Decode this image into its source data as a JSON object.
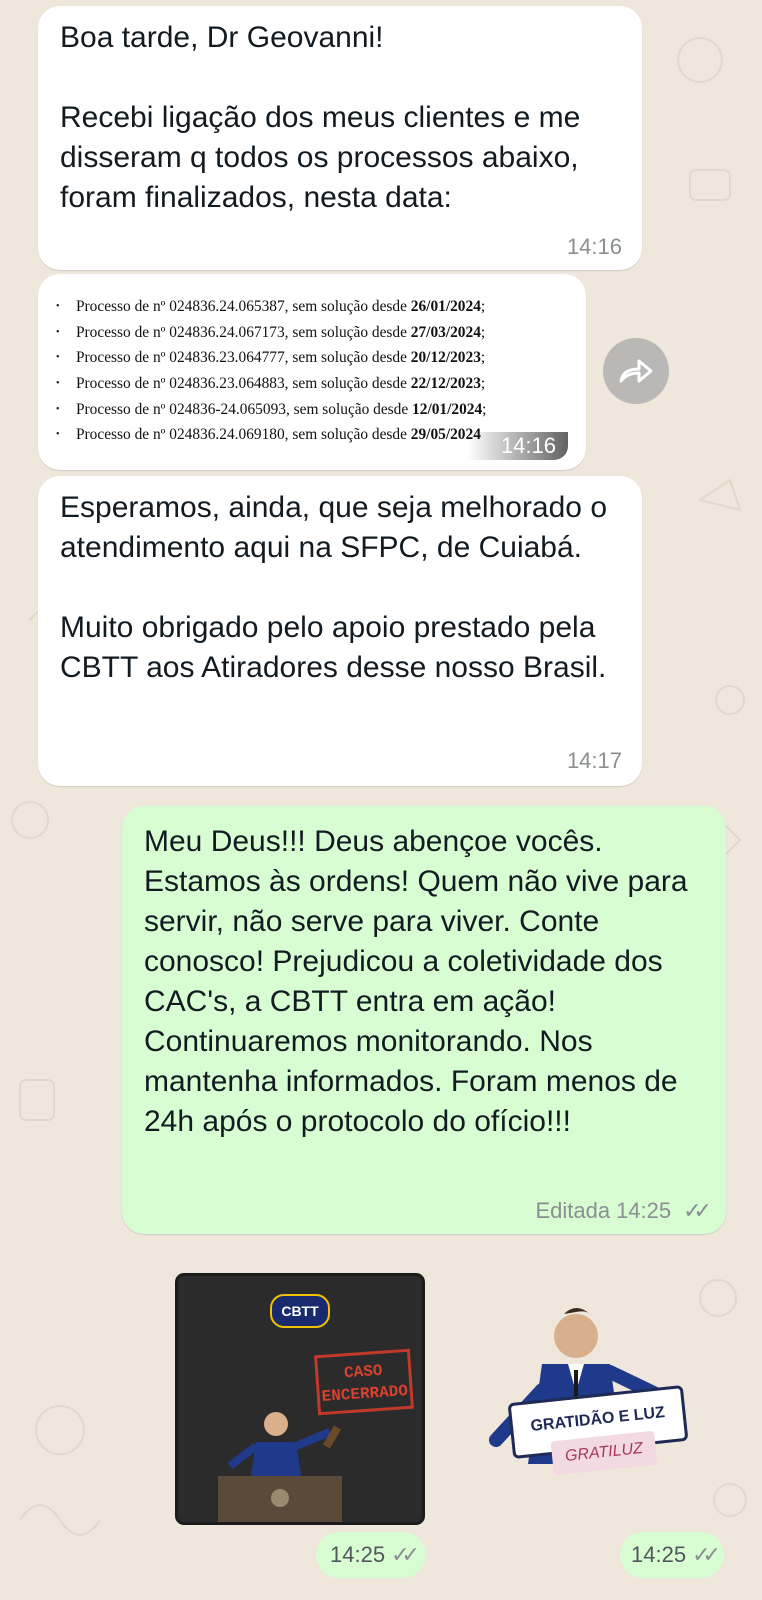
{
  "messages": {
    "m1": {
      "text": "Boa tarde, Dr Geovanni!\n\nRecebi ligação dos meus clientes e me disseram q todos os processos abaixo, foram finalizados, nesta data:",
      "time": "14:16"
    },
    "m2": {
      "time": "14:16",
      "items": [
        {
          "prefix": "Processo de nº 024836.24.065387, sem solução desde ",
          "date": "26/01/2024",
          "suffix": ";"
        },
        {
          "prefix": "Processo de nº 024836.24.067173, sem solução desde ",
          "date": "27/03/2024",
          "suffix": ";"
        },
        {
          "prefix": "Processo de nº 024836.23.064777, sem solução desde ",
          "date": "20/12/2023",
          "suffix": ";"
        },
        {
          "prefix": "Processo de nº 024836.23.064883, sem solução desde ",
          "date": "22/12/2023",
          "suffix": ";"
        },
        {
          "prefix": "Processo de nº 024836-24.065093, sem solução desde ",
          "date": "12/01/2024",
          "suffix": ";"
        },
        {
          "prefix": "Processo de nº 024836.24.069180, sem solução desde ",
          "date": "29/05/2024",
          "suffix": ""
        }
      ]
    },
    "m3": {
      "text": "Esperamos, ainda, que seja melhorado o atendimento aqui na SFPC, de Cuiabá.\n\nMuito obrigado pelo apoio prestado pela CBTT aos Atiradores desse nosso Brasil.",
      "time": "14:17"
    },
    "m4": {
      "text": "Meu Deus!!! Deus abençoe vocês. Estamos às ordens! Quem não vive para servir, não serve para viver. Conte conosco! Prejudicou a coletividade dos CAC's, a CBTT entra em ação! Continuaremos monitorando. Nos mantenha informados. Foram menos de 24h após o protocolo do ofício!!!",
      "edited_label": "Editada",
      "time": "14:25"
    },
    "m5": {
      "logo": "CBTT",
      "stamp": "CASO ENCERRADO",
      "time": "14:25"
    },
    "m6": {
      "badge": "GRATIDÃO E LUZ",
      "sub": "GRATILUZ",
      "time": "14:25"
    }
  },
  "icons": {
    "forward": "forward-icon",
    "read_ticks": "double-check-icon"
  },
  "colors": {
    "wallpaper": "#efe7dc",
    "incoming": "#ffffff",
    "outgoing": "#d9fdd3",
    "timestamp": "#8a8f92"
  }
}
